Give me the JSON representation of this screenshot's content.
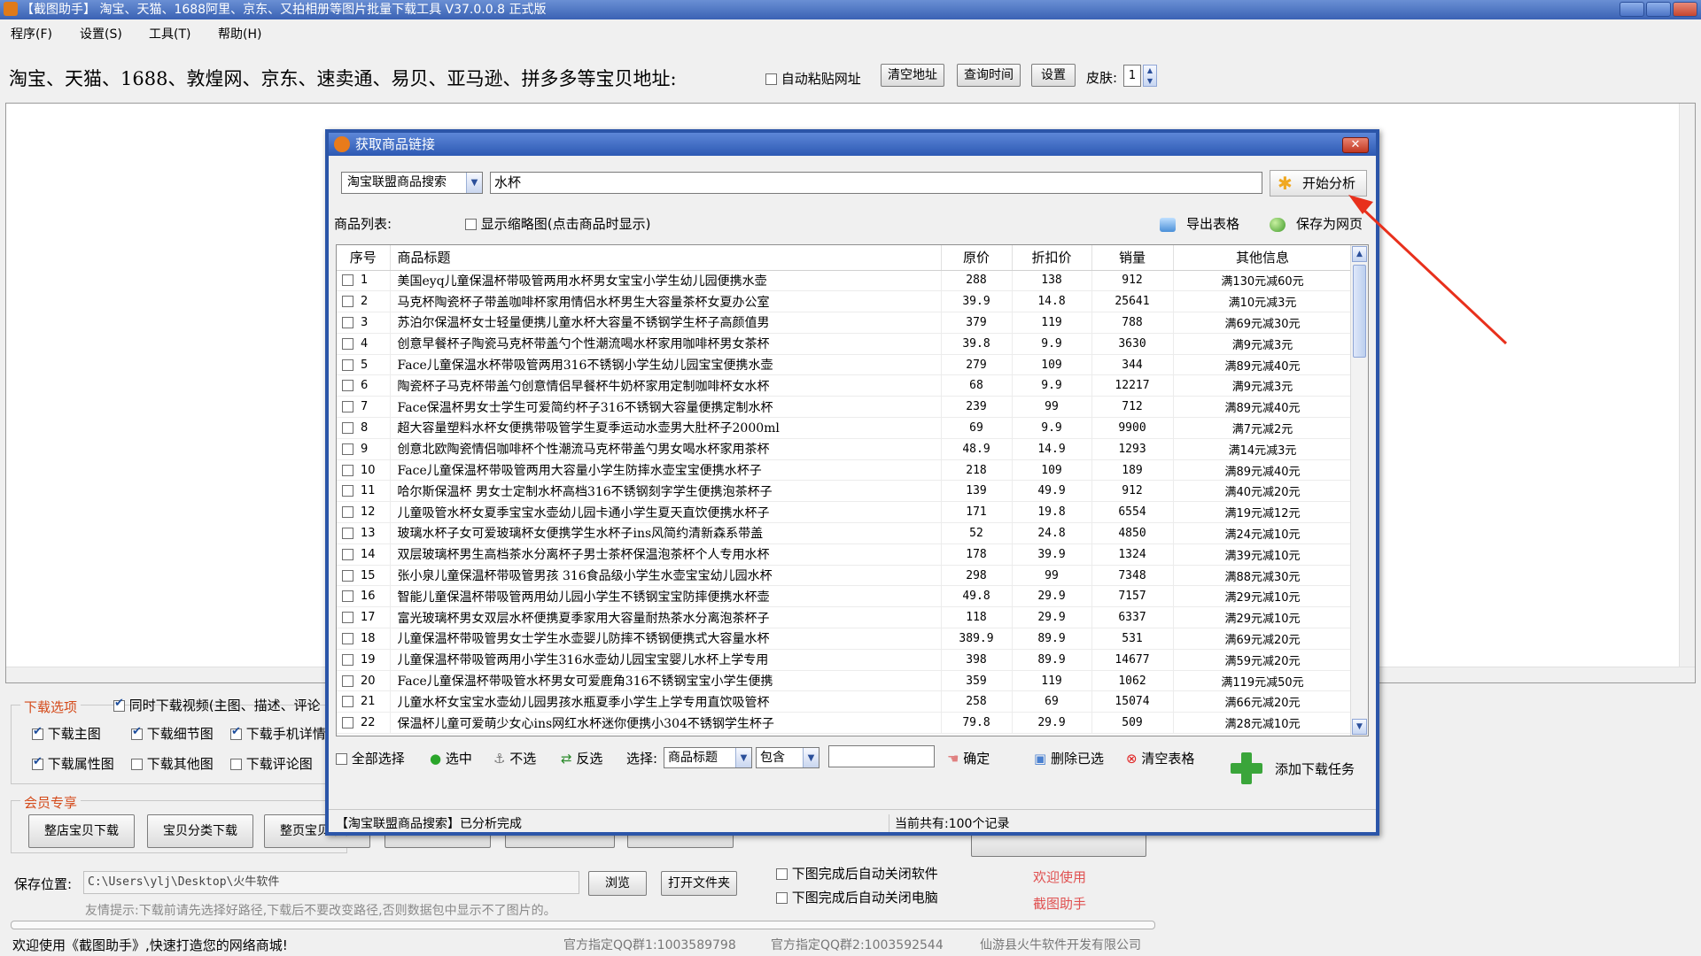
{
  "window": {
    "title": "【截图助手】 淘宝、天猫、1688阿里、京东、又拍相册等图片批量下载工具 V37.0.0.8 正式版"
  },
  "menu": [
    "程序(F)",
    "设置(S)",
    "工具(T)",
    "帮助(H)"
  ],
  "toolbar": {
    "site_label": "淘宝、天猫、1688、敦煌网、京东、速卖通、易贝、亚马逊、拼多多等宝贝地址:",
    "auto_paste": "自动粘贴网址",
    "clear_btn": "清空地址",
    "query_btn": "查询时间",
    "settings_btn": "设置",
    "skin_label": "皮肤:",
    "skin_value": "1"
  },
  "download_options": {
    "group_title": "下载选项",
    "sync_video": "同时下载视频(主图、描述、评论",
    "main_img": "下载主图",
    "detail_img": "下载细节图",
    "mobile_detail": "下载手机详情",
    "attr_img": "下载属性图",
    "other_img": "下载其他图",
    "review_img": "下载评论图"
  },
  "member": {
    "group_title": "会员专享",
    "shop_download": "整店宝贝下载",
    "category_download": "宝贝分类下载",
    "page_download": "整页宝贝下载"
  },
  "save": {
    "label": "保存位置:",
    "path": "C:\\Users\\ylj\\Desktop\\火牛软件",
    "browse": "浏览",
    "open_folder": "打开文件夹",
    "tip": "友情提示:下载前请先选择好路径,下载后不要改变路径,否则数据包中显示不了图片的。"
  },
  "after_download": {
    "close_app": "下图完成后自动关闭软件",
    "shutdown": "下图完成后自动关闭电脑"
  },
  "welcome": {
    "line1": "欢迎使用",
    "line2": "截图助手"
  },
  "statusbar": {
    "welcome": "欢迎使用《截图助手》,快速打造您的网络商城!",
    "qq1": "官方指定QQ群1:1003589798",
    "qq2": "官方指定QQ群2:1003592544",
    "company": "仙游县火牛软件开发有限公司"
  },
  "dialog": {
    "title": "获取商品链接",
    "close_glyph": "✕",
    "source": "淘宝联盟商品搜索",
    "keyword": "水杯",
    "analyze": "开始分析",
    "list_label": "商品列表:",
    "show_thumb": "显示缩略图(点击商品时显示)",
    "export": "导出表格",
    "save_web": "保存为网页",
    "columns": [
      "序号",
      "商品标题",
      "原价",
      "折扣价",
      "销量",
      "其他信息"
    ],
    "rows": [
      {
        "seq": "1",
        "title": "美国eyq儿童保温杯带吸管两用水杯男女宝宝小学生幼儿园便携水壶",
        "price": "288",
        "discount": "138",
        "sales": "912",
        "info": "满130元减60元"
      },
      {
        "seq": "2",
        "title": "马克杯陶瓷杯子带盖咖啡杯家用情侣水杯男生大容量茶杯女夏办公室",
        "price": "39.9",
        "discount": "14.8",
        "sales": "25641",
        "info": "满10元减3元"
      },
      {
        "seq": "3",
        "title": "苏泊尔保温杯女士轻量便携儿童水杯大容量不锈钢学生杯子高颜值男",
        "price": "379",
        "discount": "119",
        "sales": "788",
        "info": "满69元减30元"
      },
      {
        "seq": "4",
        "title": "创意早餐杯子陶瓷马克杯带盖勺个性潮流喝水杯家用咖啡杯男女茶杯",
        "price": "39.8",
        "discount": "9.9",
        "sales": "3630",
        "info": "满9元减3元"
      },
      {
        "seq": "5",
        "title": "Face儿童保温水杯带吸管两用316不锈钢小学生幼儿园宝宝便携水壶",
        "price": "279",
        "discount": "109",
        "sales": "344",
        "info": "满89元减40元"
      },
      {
        "seq": "6",
        "title": "陶瓷杯子马克杯带盖勺创意情侣早餐杯牛奶杯家用定制咖啡杯女水杯",
        "price": "68",
        "discount": "9.9",
        "sales": "12217",
        "info": "满9元减3元"
      },
      {
        "seq": "7",
        "title": "Face保温杯男女士学生可爱简约杯子316不锈钢大容量便携定制水杯",
        "price": "239",
        "discount": "99",
        "sales": "712",
        "info": "满89元减40元"
      },
      {
        "seq": "8",
        "title": "超大容量塑料水杯女便携带吸管学生夏季运动水壶男大肚杯子2000ml",
        "price": "69",
        "discount": "9.9",
        "sales": "9900",
        "info": "满7元减2元"
      },
      {
        "seq": "9",
        "title": "创意北欧陶瓷情侣咖啡杯个性潮流马克杯带盖勺男女喝水杯家用茶杯",
        "price": "48.9",
        "discount": "14.9",
        "sales": "1293",
        "info": "满14元减3元"
      },
      {
        "seq": "10",
        "title": "Face儿童保温杯带吸管两用大容量小学生防摔水壶宝宝便携水杯子",
        "price": "218",
        "discount": "109",
        "sales": "189",
        "info": "满89元减40元"
      },
      {
        "seq": "11",
        "title": "哈尔斯保温杯 男女士定制水杯高档316不锈钢刻字学生便携泡茶杯子",
        "price": "139",
        "discount": "49.9",
        "sales": "912",
        "info": "满40元减20元"
      },
      {
        "seq": "12",
        "title": "儿童吸管水杯女夏季宝宝水壶幼儿园卡通小学生夏天直饮便携水杯子",
        "price": "171",
        "discount": "19.8",
        "sales": "6554",
        "info": "满19元减12元"
      },
      {
        "seq": "13",
        "title": "玻璃水杯子女可爱玻璃杯女便携学生水杯子ins风简约清新森系带盖",
        "price": "52",
        "discount": "24.8",
        "sales": "4850",
        "info": "满24元减10元"
      },
      {
        "seq": "14",
        "title": "双层玻璃杯男生高档茶水分离杯子男士茶杯保温泡茶杯个人专用水杯",
        "price": "178",
        "discount": "39.9",
        "sales": "1324",
        "info": "满39元减10元"
      },
      {
        "seq": "15",
        "title": "张小泉儿童保温杯带吸管男孩 316食品级小学生水壶宝宝幼儿园水杯",
        "price": "298",
        "discount": "99",
        "sales": "7348",
        "info": "满88元减30元"
      },
      {
        "seq": "16",
        "title": "智能儿童保温杯带吸管两用幼儿园小学生不锈钢宝宝防摔便携水杯壶",
        "price": "49.8",
        "discount": "29.9",
        "sales": "7157",
        "info": "满29元减10元"
      },
      {
        "seq": "17",
        "title": "富光玻璃杯男女双层水杯便携夏季家用大容量耐热茶水分离泡茶杯子",
        "price": "118",
        "discount": "29.9",
        "sales": "6337",
        "info": "满29元减10元"
      },
      {
        "seq": "18",
        "title": "儿童保温杯带吸管男女士学生水壶婴儿防摔不锈钢便携式大容量水杯",
        "price": "389.9",
        "discount": "89.9",
        "sales": "531",
        "info": "满69元减20元"
      },
      {
        "seq": "19",
        "title": "儿童保温杯带吸管两用小学生316水壶幼儿园宝宝婴儿水杯上学专用",
        "price": "398",
        "discount": "89.9",
        "sales": "14677",
        "info": "满59元减20元"
      },
      {
        "seq": "20",
        "title": "Face儿童保温杯带吸管水杯男女可爱鹿角316不锈钢宝宝小学生便携",
        "price": "359",
        "discount": "119",
        "sales": "1062",
        "info": "满119元减50元"
      },
      {
        "seq": "21",
        "title": "儿童水杯女宝宝水壶幼儿园男孩水瓶夏季小学生上学专用直饮吸管杯",
        "price": "258",
        "discount": "69",
        "sales": "15074",
        "info": "满66元减20元"
      },
      {
        "seq": "22",
        "title": "保温杯儿童可爱萌少女心ins网红水杯迷你便携小304不锈钢学生杯子",
        "price": "79.8",
        "discount": "29.9",
        "sales": "509",
        "info": "满28元减10元"
      }
    ],
    "bottom": {
      "select_all": "全部选择",
      "select": "选中",
      "unselect": "不选",
      "invert": "反选",
      "choose_label": "选择:",
      "field": "商品标题",
      "match": "包含",
      "match_value": "",
      "confirm": "确定",
      "delete_selected": "删除已选",
      "clear_table": "清空表格",
      "add_task": "添加下载任务"
    },
    "status_left": "【淘宝联盟商品搜索】已分析完成",
    "status_right": "当前共有:100个记录"
  },
  "colors": {
    "accent_red": "#e8301c",
    "title_blue": "#2d59b3",
    "group_title": "#d44a1a",
    "welcome_red": "#e05050"
  }
}
